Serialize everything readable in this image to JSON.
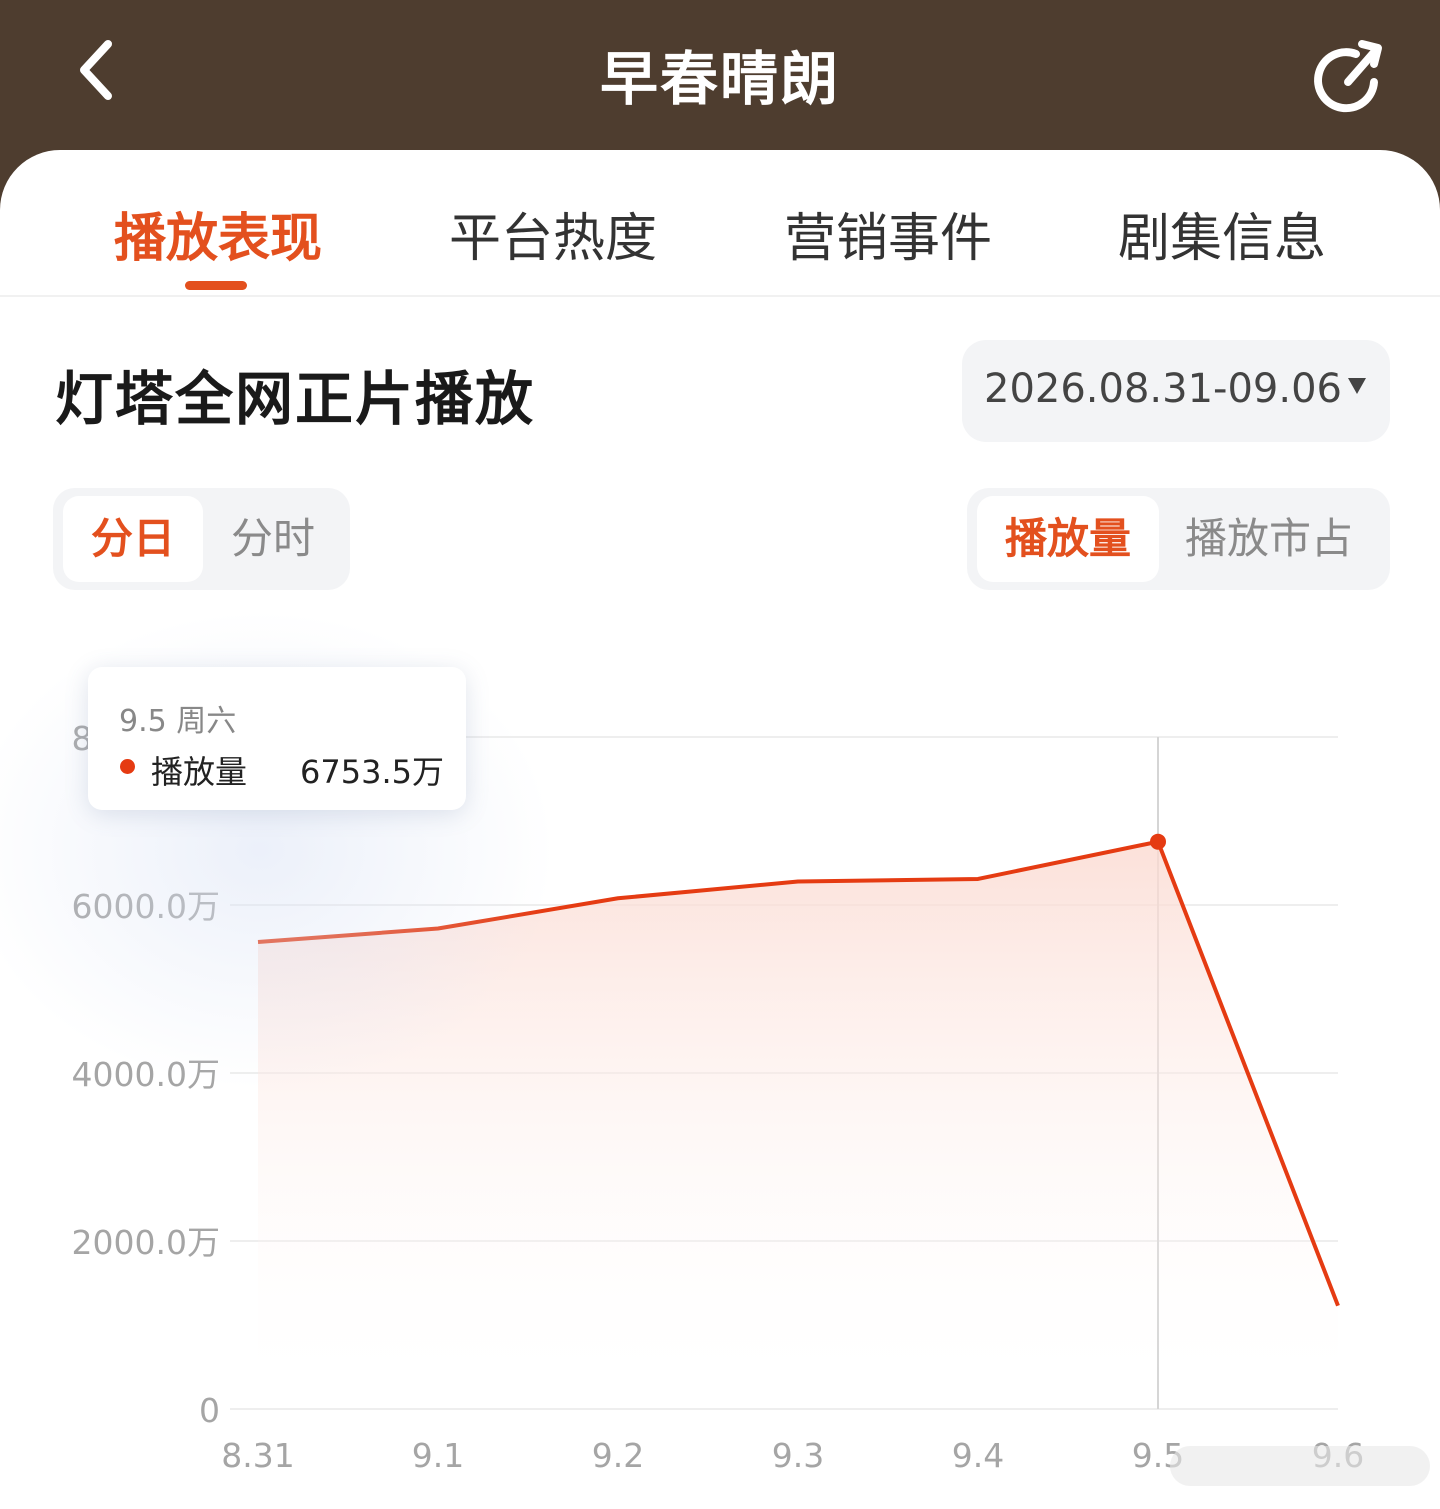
{
  "header": {
    "title": "早春晴朗",
    "back_icon": "chevron-left-icon",
    "refresh_icon": "refresh-icon"
  },
  "tabs": [
    {
      "label": "播放表现",
      "active": true
    },
    {
      "label": "平台热度",
      "active": false
    },
    {
      "label": "营销事件",
      "active": false
    },
    {
      "label": "剧集信息",
      "active": false
    }
  ],
  "section": {
    "title": "灯塔全网正片播放",
    "date_range": "2026.08.31-09.06"
  },
  "granularity": {
    "options": [
      "分日",
      "分时"
    ],
    "selected": "分日"
  },
  "metric": {
    "options": [
      "播放量",
      "播放市占"
    ],
    "selected": "播放量"
  },
  "tooltip": {
    "date": "9.5  周六",
    "series": "播放量",
    "value": "6753.5万"
  },
  "colors": {
    "accent": "#e3501e",
    "line": "#e53b12",
    "header_bg": "#4e3d2f"
  },
  "chart_data": {
    "type": "area",
    "categories": [
      "8.31",
      "9.1",
      "9.2",
      "9.3",
      "9.4",
      "9.5",
      "9.6"
    ],
    "series": [
      {
        "name": "播放量",
        "values": [
          5560,
          5720,
          6080,
          6280,
          6310,
          6753.5,
          1230
        ]
      }
    ],
    "y_ticks": [
      "0",
      "2000.0万",
      "4000.0万",
      "6000.0万",
      "8000.0万"
    ],
    "ylim": [
      0,
      8000
    ],
    "highlight_category": "9.5",
    "grid": true
  }
}
